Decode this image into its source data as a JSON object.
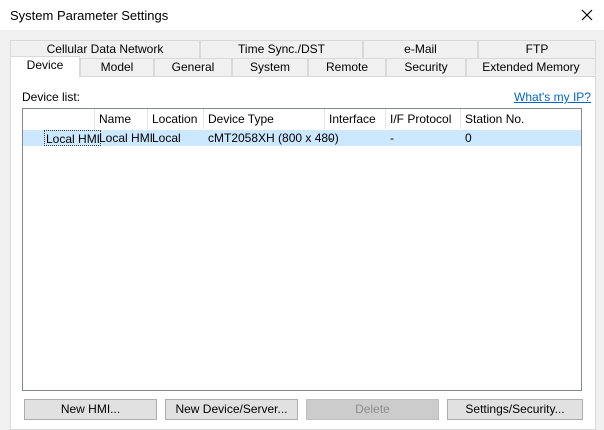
{
  "window": {
    "title": "System Parameter Settings"
  },
  "tabs_row1": [
    {
      "label": "Cellular Data Network"
    },
    {
      "label": "Time Sync./DST"
    },
    {
      "label": "e-Mail"
    },
    {
      "label": "FTP"
    }
  ],
  "tabs_row2": [
    {
      "label": "Device"
    },
    {
      "label": "Model"
    },
    {
      "label": "General"
    },
    {
      "label": "System"
    },
    {
      "label": "Remote"
    },
    {
      "label": "Security"
    },
    {
      "label": "Extended Memory"
    }
  ],
  "device_list": {
    "label": "Device list:",
    "whats_my_ip": "What's my IP?",
    "columns": [
      "Name",
      "Location",
      "Device Type",
      "Interface",
      "I/F Protocol",
      "Station No."
    ],
    "rows": [
      {
        "group": "Local HMI",
        "name": "Local HMI",
        "location": "Local",
        "device_type": "cMT2058XH (800 x 480)",
        "interface": "-",
        "if_protocol": "-",
        "station_no": "0"
      }
    ]
  },
  "buttons": {
    "new_hmi": "New HMI...",
    "new_device": "New Device/Server...",
    "delete": "Delete",
    "settings_security": "Settings/Security..."
  },
  "colors": {
    "selection": "#cce8ff",
    "link": "#0066cc"
  }
}
